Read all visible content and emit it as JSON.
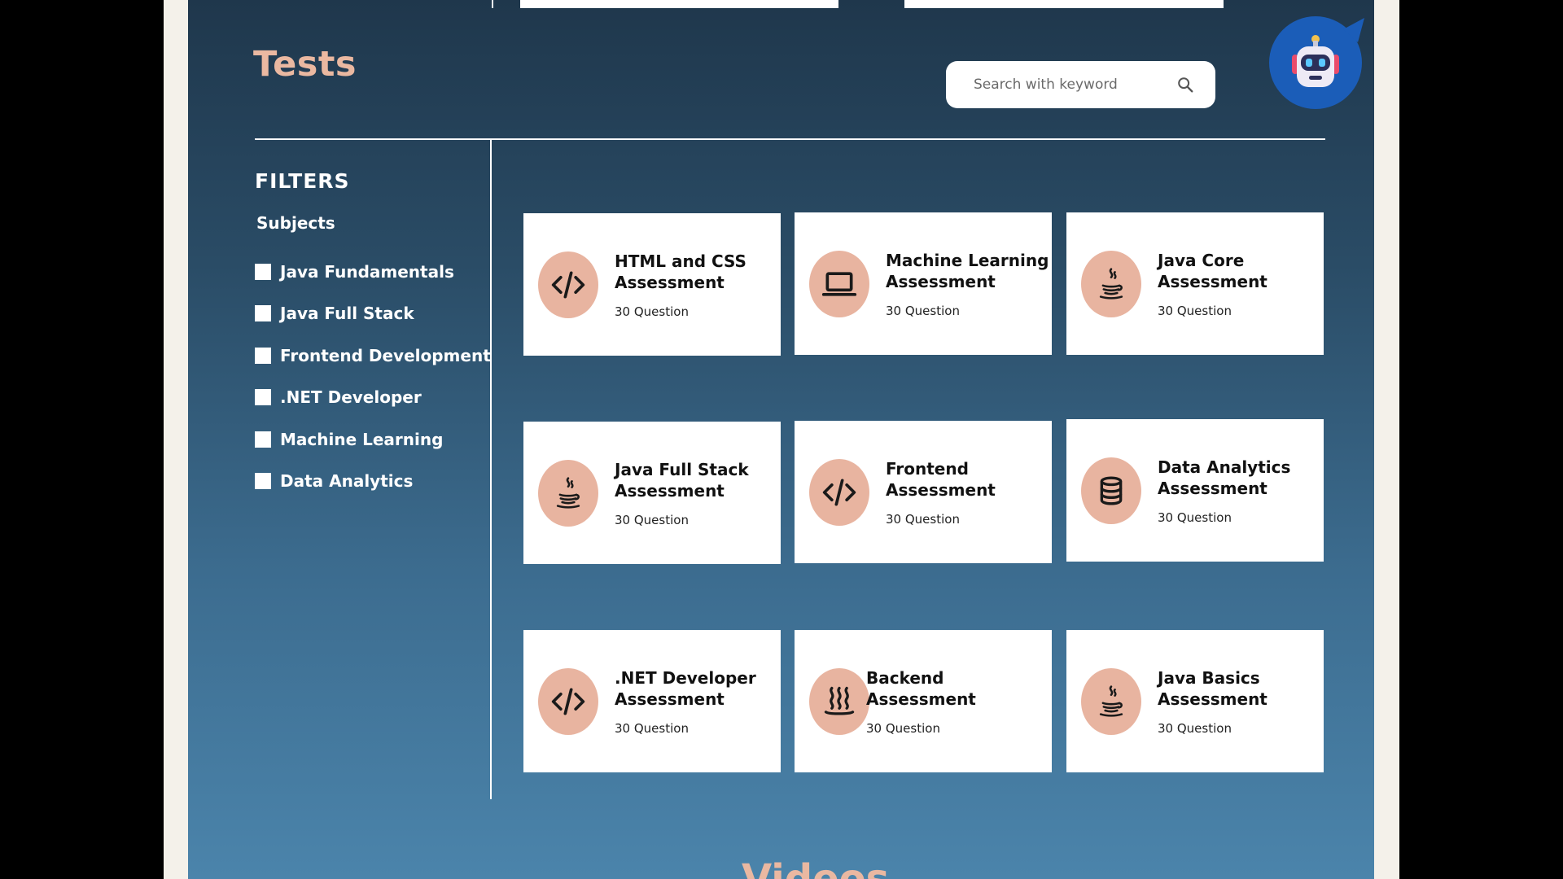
{
  "tests": {
    "title": "Tests",
    "search": {
      "placeholder": "Search with keyword",
      "value": ""
    }
  },
  "filters": {
    "title": "FILTERS",
    "subjects_label": "Subjects",
    "subjects": [
      {
        "label": "Java Fundamentals",
        "checked": false
      },
      {
        "label": "Java Full Stack",
        "checked": false
      },
      {
        "label": "Frontend Development",
        "checked": false
      },
      {
        "label": ".NET Developer",
        "checked": false
      },
      {
        "label": "Machine Learning",
        "checked": false
      },
      {
        "label": "Data Analytics",
        "checked": false
      }
    ]
  },
  "cards": [
    {
      "title_line1": "HTML and CSS",
      "title_line2": "Assessment",
      "count": "30 Question",
      "icon": "code-icon"
    },
    {
      "title_line1": "Machine Learning",
      "title_line2": "Assessment",
      "count": "30 Question",
      "icon": "laptop-icon"
    },
    {
      "title_line1": "Java Core",
      "title_line2": "Assessment",
      "count": "30 Question",
      "icon": "java-cup-icon"
    },
    {
      "title_line1": "Java Full Stack",
      "title_line2": "Assessment",
      "count": "30 Question",
      "icon": "java-cup-icon"
    },
    {
      "title_line1": "Frontend",
      "title_line2": "Assessment",
      "count": "30 Question",
      "icon": "code-icon"
    },
    {
      "title_line1": "Data Analytics",
      "title_line2": "Assessment",
      "count": "30 Question",
      "icon": "database-icon"
    },
    {
      "title_line1": ".NET Developer",
      "title_line2": "Assessment",
      "count": "30 Question",
      "icon": "code-icon"
    },
    {
      "title_line1": "Backend",
      "title_line2": "Assessment",
      "count": "30 Question",
      "icon": "steam-icon"
    },
    {
      "title_line1": "Java Basics",
      "title_line2": "Assessment",
      "count": "30 Question",
      "icon": "java-cup-icon"
    }
  ],
  "videos": {
    "title": "Videos"
  },
  "colors": {
    "accent_peach": "#eab8a1",
    "icon_circle": "#e8b4a0",
    "panel_top": "#1f374c",
    "panel_bottom": "#4b84ab"
  }
}
